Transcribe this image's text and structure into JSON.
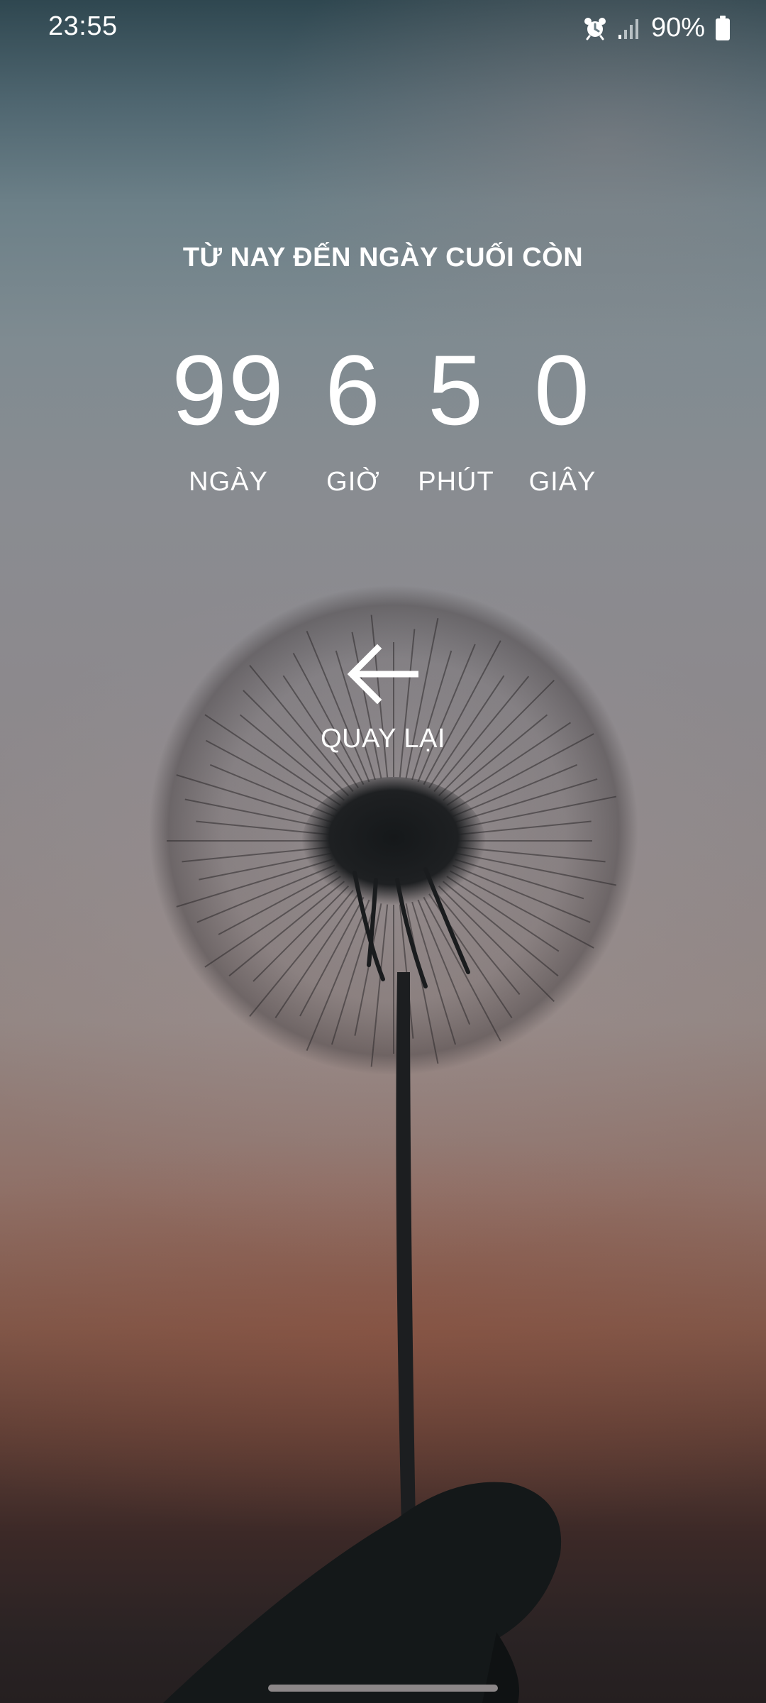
{
  "status_bar": {
    "time": "23:55",
    "alarm_icon": "alarm-clock-icon",
    "signal_icon": "signal-bars-icon",
    "battery_percent": "90%",
    "battery_icon": "battery-icon"
  },
  "header": {
    "title": "TỪ NAY ĐẾN NGÀY CUỐI CÒN"
  },
  "countdown": {
    "days": {
      "value": "99",
      "label": "NGÀY"
    },
    "hours": {
      "value": "6",
      "label": "GIỜ"
    },
    "minutes": {
      "value": "5",
      "label": "PHÚT"
    },
    "seconds": {
      "value": "0",
      "label": "GIÂY"
    }
  },
  "back": {
    "icon": "arrow-left-icon",
    "label": "QUAY LẠI"
  },
  "colors": {
    "text": "#ffffff",
    "sky_top": "#2f4750",
    "sunset": "#7e5749",
    "bottom": "#251f20"
  }
}
